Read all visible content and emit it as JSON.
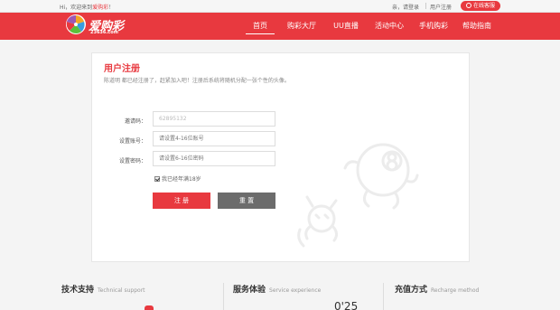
{
  "topbar": {
    "greeting_prefix": "Hi，欢迎来到",
    "greeting_brand": "爱购彩",
    "greeting_suffix": "！",
    "login": "亲，请登录",
    "register": "用户注册",
    "service": "在线客服"
  },
  "logo": {
    "name": "爱购彩",
    "url": "23636.com"
  },
  "nav": {
    "items": [
      "首页",
      "购彩大厅",
      "UU直播",
      "活动中心",
      "手机购彩",
      "帮助指南"
    ],
    "active_index": 0
  },
  "form": {
    "title": "用户注册",
    "subtitle": "陈道明 都已经注册了，赶紧加入吧！注册后系统将随机分配一张个性的头像。",
    "invite_label": "邀请码：",
    "invite_value": "62895132",
    "account_label": "设置账号：",
    "account_placeholder": "请设置4-16位账号",
    "password_label": "设置密码：",
    "password_placeholder": "请设置6-16位密码",
    "agree_text": "我已经年满18岁",
    "agree_checked": true,
    "submit_label": "注 册",
    "reset_label": "重 置"
  },
  "footer": {
    "tech_title": "技术支持",
    "tech_en": "Technical support",
    "service_title": "服务体验",
    "service_en": "Service experience",
    "recharge_title": "充值方式",
    "recharge_en": "Recharge method",
    "partial_number": "0'25"
  },
  "colors": {
    "brand_red": "#e8393f",
    "reset_gray": "#6c6c6c"
  },
  "icons": [
    "headset-icon",
    "logo-pinwheel-icon",
    "checkbox-checked-icon",
    "mascot-illustration"
  ]
}
